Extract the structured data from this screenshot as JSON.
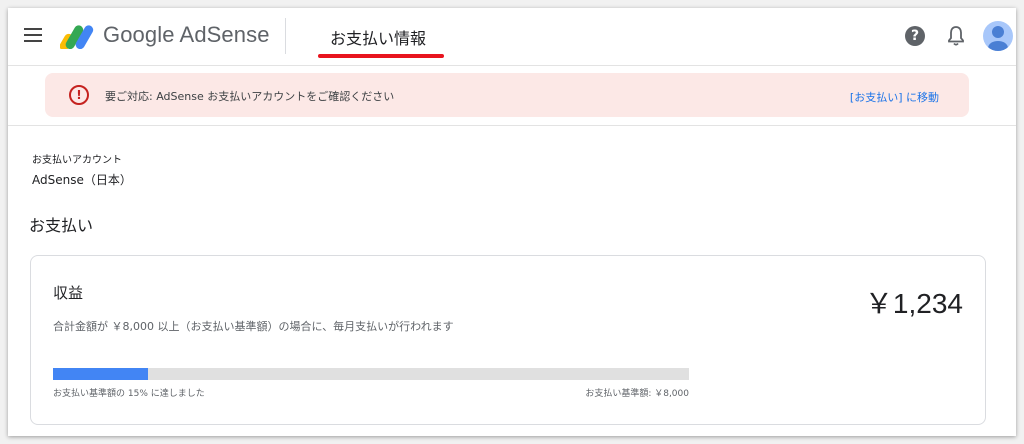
{
  "header": {
    "logo_text": "Google AdSense",
    "page_title": "お支払い情報",
    "icons": [
      "menu-icon",
      "adsense-logo-icon",
      "help-icon",
      "bell-icon",
      "avatar-icon"
    ],
    "help_glyph": "?"
  },
  "alert": {
    "icon_glyph": "!",
    "message": "要ご対応: AdSense お支払いアカウントをご確認ください",
    "link": "[お支払い] に移動",
    "color": "#fce8e6"
  },
  "account": {
    "label": "お支払いアカウント",
    "value": "AdSense（日本）"
  },
  "payments": {
    "heading": "お支払い",
    "card": {
      "title": "収益",
      "amount": "￥1,234",
      "description": "合計金額が ￥8,000 以上（お支払い基準額）の場合に、毎月支払いが行われます",
      "progress_percent": 15,
      "progress_left_label": "お支払い基準額の 15% に達しました",
      "progress_right_label": "お支払い基準額: ￥8,000",
      "progress_color": "#4285f4"
    }
  },
  "colors": {
    "underline": "#e8141e",
    "link": "#1a73e8",
    "alert_icon": "#c5221f"
  }
}
